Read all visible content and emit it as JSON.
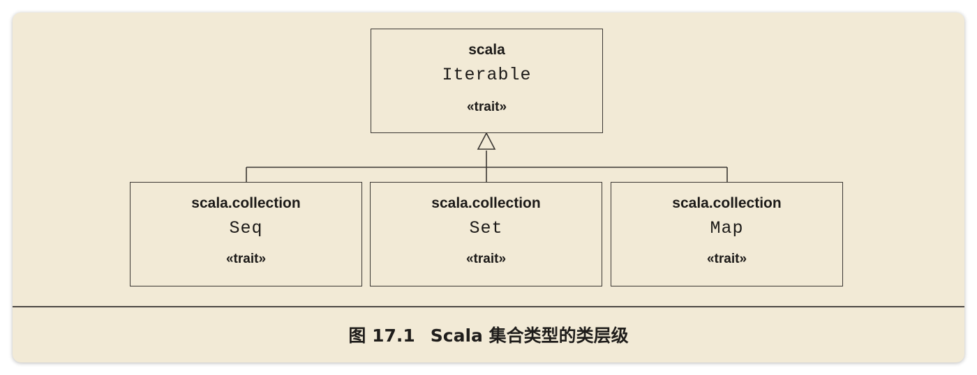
{
  "diagram": {
    "root": {
      "package": "scala",
      "name": "Iterable",
      "stereotype": "«trait»"
    },
    "children": [
      {
        "package": "scala.collection",
        "name": "Seq",
        "stereotype": "«trait»"
      },
      {
        "package": "scala.collection",
        "name": "Set",
        "stereotype": "«trait»"
      },
      {
        "package": "scala.collection",
        "name": "Map",
        "stereotype": "«trait»"
      }
    ]
  },
  "caption": {
    "label": "图 17.1",
    "text": "Scala 集合类型的类层级"
  }
}
